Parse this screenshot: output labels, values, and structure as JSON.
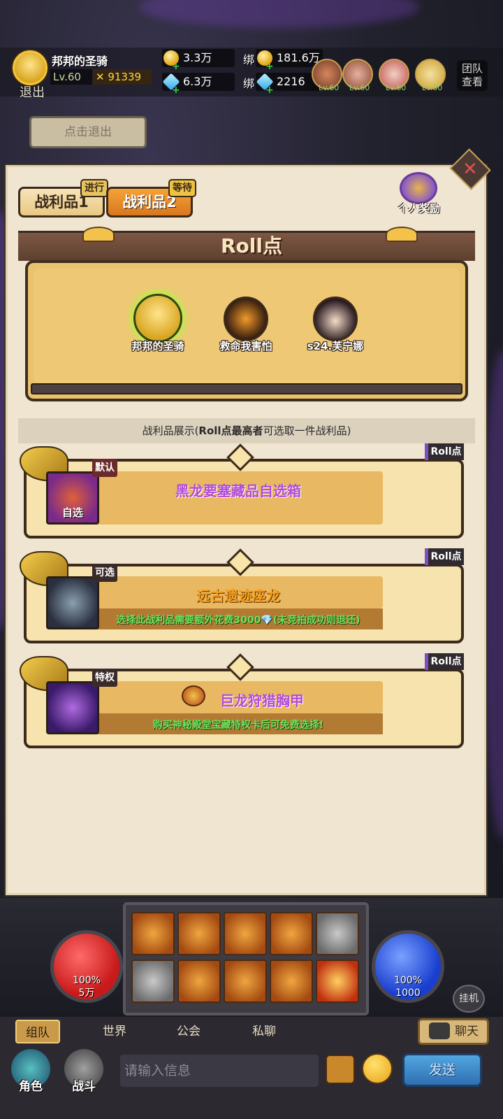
{
  "header": {
    "player_name": "邦邦的圣骑",
    "level": "Lv.60",
    "power": "91339",
    "exit_label": "退出",
    "gold": "3.3万",
    "gems": "6.3万",
    "bound_label": "绑",
    "bound_gold": "181.6万",
    "bound_gems": "2216",
    "team_levels": [
      "Lv.60",
      "Lv.60",
      "Lv.60",
      "Lv.60",
      "Lv.60"
    ],
    "team_view": "团队查看",
    "click_exit": "点击退出"
  },
  "tabs": [
    {
      "label": "战利品1",
      "badge": "进行"
    },
    {
      "label": "战利品2",
      "badge": "等待"
    }
  ],
  "personal_reward": "个人奖励",
  "roll": {
    "title": "Roll点",
    "players": [
      {
        "name": "邦邦的圣骑"
      },
      {
        "name": "救命我害怕"
      },
      {
        "name": "s24.芙宁娜"
      }
    ]
  },
  "loot_caption_prefix": "战利品展示(",
  "loot_caption_bold": "Roll点最高者",
  "loot_caption_suffix": "可选取一件战利品)",
  "loot": [
    {
      "tag": "默认",
      "name": "黑龙要塞藏品自选箱",
      "icon_label": "自选",
      "roll_label": "Roll点",
      "sub": ""
    },
    {
      "tag": "可选",
      "name": "远古遗迹座龙",
      "icon_label": "",
      "roll_label": "Roll点",
      "sub": "选择此战利品需要额外花费3000💎(未竞拍成功则退还)"
    },
    {
      "tag": "特权",
      "name": "巨龙狩猎胸甲",
      "icon_label": "",
      "roll_label": "Roll点",
      "sub": "购买神秘殿堂宝藏特权卡后可免费选择!"
    }
  ],
  "hud": {
    "hp_pct": "100%",
    "hp_val": "5万",
    "mp_pct": "100%",
    "mp_val": "1000",
    "auto": "挂机"
  },
  "chat": {
    "tabs": [
      "组队",
      "世界",
      "公会",
      "私聊"
    ],
    "chat_btn": "聊天",
    "placeholder": "请输入信息",
    "send": "发送",
    "role": "角色",
    "battle": "战斗"
  }
}
